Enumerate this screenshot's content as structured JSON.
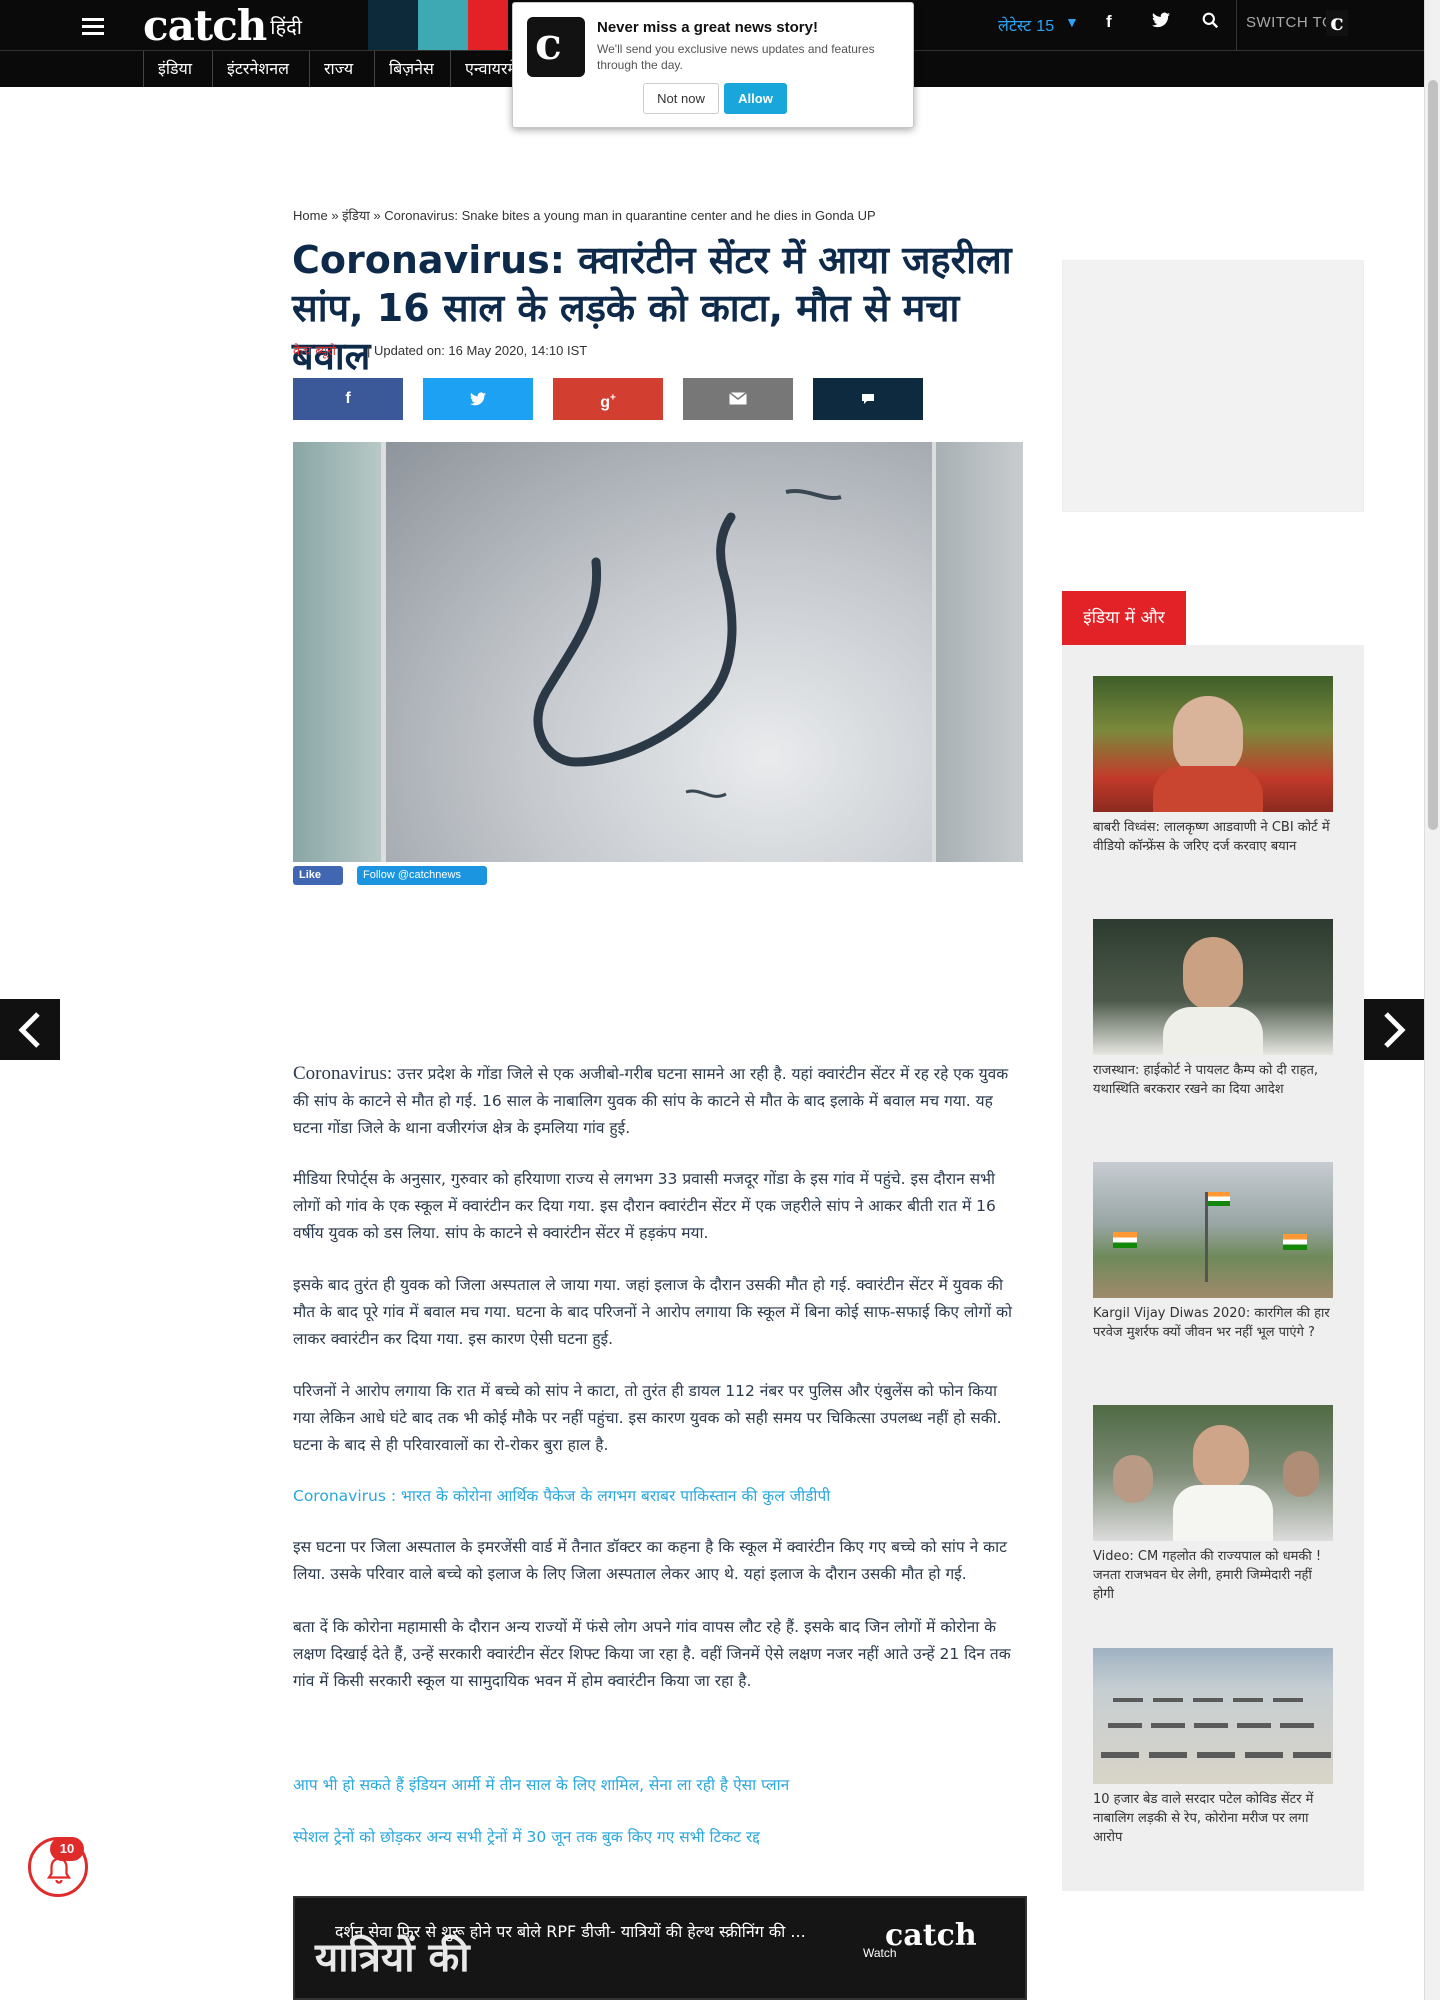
{
  "header": {
    "logo": "catch",
    "logo_hindi": "हिंदी",
    "latest_label": "लेटेस्ट",
    "latest_count": "15",
    "switch_label": "SWITCH TO",
    "switch_logo": "c"
  },
  "nav": [
    "इंडिया",
    "इंटरनेशनल",
    "राज्य",
    "बिज़नेस",
    "एन्वायरमें"
  ],
  "notification": {
    "title": "Never miss a great news story!",
    "text": "We'll send you exclusive news updates and features through the day.",
    "not_now": "Not now",
    "allow": "Allow",
    "icon": "c"
  },
  "breadcrumb": {
    "home": "Home",
    "sep": "»",
    "section": "इंडिया",
    "current": "Coronavirus: Snake bites a young man in quarantine center and he dies in Gonda UP"
  },
  "article": {
    "headline": "Coronavirus: क्वारंटीन सेंटर में आया जहरीला सांप, 16 साल के लड़के को काटा, मौत से मचा बवाल",
    "author": "कैच ब्यूरो",
    "updated": "| Updated on: 16 May 2020, 14:10 IST",
    "fb_like": "Like",
    "tw_follow": "Follow @catchnews",
    "lead_word": "Coronavirus:",
    "p1": "उत्तर प्रदेश के गोंडा जिले से एक अजीबो-गरीब घटना सामने आ रही है. यहां क्वारंटीन सेंटर में रह रहे एक युवक की सांप के काटने से मौत हो गई. 16 साल के नाबालिग युवक की सांप के काटने से मौत के बाद इलाके में बवाल मच गया. यह घटना गोंडा जिले के थाना वजीरगंज क्षेत्र के इमलिया गांव हुई.",
    "p2": "मीडिया रिपोर्ट्स के अनुसार, गुरुवार को हरियाणा राज्य से लगभग 33 प्रवासी मजदूर गोंडा के इस गांव में पहुंचे. इस दौरान सभी लोगों को गांव के एक स्कूल में क्वारंटीन कर दिया गया. इस दौरान क्वारंटीन सेंटर में एक जहरीले सांप ने आकर बीती रात में 16 वर्षीय युवक को डस लिया. सांप के काटने से क्वारंटीन सेंटर में हड़कंप मया.",
    "p3": "इसके बाद तुरंत ही युवक को जिला अस्पताल ले जाया गया. जहां इलाज के दौरान उसकी मौत हो गई. क्वारंटीन सेंटर में युवक की मौत के बाद पूरे गांव में बवाल मच गया. घटना के बाद परिजनों ने आरोप लगाया कि स्कूल में बिना कोई साफ-सफाई किए लोगों को लाकर क्वारंटीन कर दिया गया. इस कारण ऐसी घटना हुई.",
    "p4": "परिजनों ने आरोप लगाया कि रात में बच्चे को सांप ने काटा, तो तुरंत ही डायल 112 नंबर पर पुलिस और एंबुलेंस को फोन किया गया लेकिन आधे घंटे बाद तक भी कोई मौके पर नहीं पहुंचा. इस कारण युवक को सही समय पर चिकित्सा उपलब्ध नहीं हो सकी. घटना के बाद से ही परिवारवालों का रो-रोकर बुरा हाल है.",
    "link1": "Coronavirus : भारत के कोरोना आर्थिक पैकेज के लगभग बराबर पाकिस्तान की कुल जीडीपी",
    "p5": "इस घटना पर जिला अस्पताल के इमरजेंसी वार्ड में तैनात डॉक्टर का कहना है कि स्कूल में क्वारंटीन किए गए बच्चे को सांप ने काट लिया. उसके परिवार वाले बच्चे को इलाज के लिए जिला अस्पताल लेकर आए थे. यहां इलाज के दौरान उसकी मौत हो गई.",
    "p6": "बता दें कि कोरोना महामासी के दौरान अन्य राज्यों में फंसे लोग अपने गांव वापस लौट रहे हैं. इसके बाद जिन लोगों में कोरोना के लक्षण दिखाई देते हैं, उन्हें सरकारी क्वारंटीन सेंटर शिफ्ट किया जा रहा है. वहीं जिनमें ऐसे लक्षण नजर नहीं आते उन्हें 21 दिन तक गांव में किसी सरकारी स्कूल या सामुदायिक भवन में होम क्वारंटीन किया जा रहा है.",
    "link2": "आप भी हो सकते हैं इंडियन आर्मी में तीन साल के लिए शामिल, सेना ला रही है ऐसा प्लान",
    "link3": "स्पेशल ट्रेनों को छोड़कर अन्य सभी ट्रेनों में 30 जून तक बुक किए गए सभी टिकट रद्द"
  },
  "video": {
    "title": "दर्शन सेवा फिर से शुरू होने पर बोले RPF डीजी- यात्रियों की हेल्थ स्क्रीनिंग की ...",
    "big_text": "यात्रियों की",
    "logo": "catch",
    "watch": "Watch"
  },
  "sidebar": {
    "tag": "इंडिया में और",
    "cards": [
      {
        "text": "बाबरी विध्वंस: लालकृष्ण आडवाणी ने CBI कोर्ट में वीडियो कॉन्फ्रेंस के जरिए दर्ज करवाए बयान"
      },
      {
        "text": "राजस्थान: हाईकोर्ट ने पायलट कैम्प को दी राहत, यथास्थिति बरकरार रखने का दिया आदेश"
      },
      {
        "text": "Kargil Vijay Diwas 2020: कारगिल की हार परवेज मुशर्रफ क्यों जीवन भर नहीं भूल पाएंगे ?"
      },
      {
        "text": "Video: CM गहलोत की राज्यपाल को धमकी ! जनता राजभवन घेर लेगी, हमारी जिम्मेदारी नहीं होगी"
      },
      {
        "text": "10 हजार बेड वाले सरदार पटेल कोविड सेंटर में नाबालिग लड़की से रेप, कोरोना मरीज पर लगा आरोप"
      }
    ]
  },
  "notifications_badge": "10",
  "colors": {
    "brand_red": "#e32227",
    "facebook": "#3b5998",
    "twitter": "#1da1f2",
    "google": "#d23f31",
    "email": "#777777",
    "comment": "#0e2a3f",
    "link": "#2aa7dc"
  }
}
